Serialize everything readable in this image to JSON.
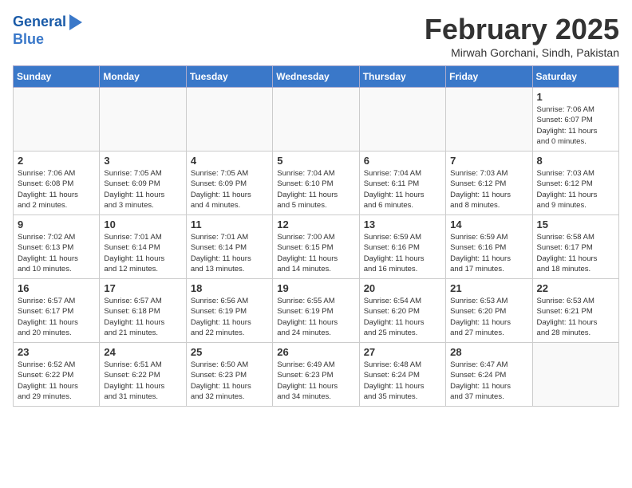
{
  "header": {
    "logo_line1": "General",
    "logo_line2": "Blue",
    "month_title": "February 2025",
    "location": "Mirwah Gorchani, Sindh, Pakistan"
  },
  "weekdays": [
    "Sunday",
    "Monday",
    "Tuesday",
    "Wednesday",
    "Thursday",
    "Friday",
    "Saturday"
  ],
  "weeks": [
    [
      {
        "day": "",
        "info": ""
      },
      {
        "day": "",
        "info": ""
      },
      {
        "day": "",
        "info": ""
      },
      {
        "day": "",
        "info": ""
      },
      {
        "day": "",
        "info": ""
      },
      {
        "day": "",
        "info": ""
      },
      {
        "day": "1",
        "info": "Sunrise: 7:06 AM\nSunset: 6:07 PM\nDaylight: 11 hours\nand 0 minutes."
      }
    ],
    [
      {
        "day": "2",
        "info": "Sunrise: 7:06 AM\nSunset: 6:08 PM\nDaylight: 11 hours\nand 2 minutes."
      },
      {
        "day": "3",
        "info": "Sunrise: 7:05 AM\nSunset: 6:09 PM\nDaylight: 11 hours\nand 3 minutes."
      },
      {
        "day": "4",
        "info": "Sunrise: 7:05 AM\nSunset: 6:09 PM\nDaylight: 11 hours\nand 4 minutes."
      },
      {
        "day": "5",
        "info": "Sunrise: 7:04 AM\nSunset: 6:10 PM\nDaylight: 11 hours\nand 5 minutes."
      },
      {
        "day": "6",
        "info": "Sunrise: 7:04 AM\nSunset: 6:11 PM\nDaylight: 11 hours\nand 6 minutes."
      },
      {
        "day": "7",
        "info": "Sunrise: 7:03 AM\nSunset: 6:12 PM\nDaylight: 11 hours\nand 8 minutes."
      },
      {
        "day": "8",
        "info": "Sunrise: 7:03 AM\nSunset: 6:12 PM\nDaylight: 11 hours\nand 9 minutes."
      }
    ],
    [
      {
        "day": "9",
        "info": "Sunrise: 7:02 AM\nSunset: 6:13 PM\nDaylight: 11 hours\nand 10 minutes."
      },
      {
        "day": "10",
        "info": "Sunrise: 7:01 AM\nSunset: 6:14 PM\nDaylight: 11 hours\nand 12 minutes."
      },
      {
        "day": "11",
        "info": "Sunrise: 7:01 AM\nSunset: 6:14 PM\nDaylight: 11 hours\nand 13 minutes."
      },
      {
        "day": "12",
        "info": "Sunrise: 7:00 AM\nSunset: 6:15 PM\nDaylight: 11 hours\nand 14 minutes."
      },
      {
        "day": "13",
        "info": "Sunrise: 6:59 AM\nSunset: 6:16 PM\nDaylight: 11 hours\nand 16 minutes."
      },
      {
        "day": "14",
        "info": "Sunrise: 6:59 AM\nSunset: 6:16 PM\nDaylight: 11 hours\nand 17 minutes."
      },
      {
        "day": "15",
        "info": "Sunrise: 6:58 AM\nSunset: 6:17 PM\nDaylight: 11 hours\nand 18 minutes."
      }
    ],
    [
      {
        "day": "16",
        "info": "Sunrise: 6:57 AM\nSunset: 6:17 PM\nDaylight: 11 hours\nand 20 minutes."
      },
      {
        "day": "17",
        "info": "Sunrise: 6:57 AM\nSunset: 6:18 PM\nDaylight: 11 hours\nand 21 minutes."
      },
      {
        "day": "18",
        "info": "Sunrise: 6:56 AM\nSunset: 6:19 PM\nDaylight: 11 hours\nand 22 minutes."
      },
      {
        "day": "19",
        "info": "Sunrise: 6:55 AM\nSunset: 6:19 PM\nDaylight: 11 hours\nand 24 minutes."
      },
      {
        "day": "20",
        "info": "Sunrise: 6:54 AM\nSunset: 6:20 PM\nDaylight: 11 hours\nand 25 minutes."
      },
      {
        "day": "21",
        "info": "Sunrise: 6:53 AM\nSunset: 6:20 PM\nDaylight: 11 hours\nand 27 minutes."
      },
      {
        "day": "22",
        "info": "Sunrise: 6:53 AM\nSunset: 6:21 PM\nDaylight: 11 hours\nand 28 minutes."
      }
    ],
    [
      {
        "day": "23",
        "info": "Sunrise: 6:52 AM\nSunset: 6:22 PM\nDaylight: 11 hours\nand 29 minutes."
      },
      {
        "day": "24",
        "info": "Sunrise: 6:51 AM\nSunset: 6:22 PM\nDaylight: 11 hours\nand 31 minutes."
      },
      {
        "day": "25",
        "info": "Sunrise: 6:50 AM\nSunset: 6:23 PM\nDaylight: 11 hours\nand 32 minutes."
      },
      {
        "day": "26",
        "info": "Sunrise: 6:49 AM\nSunset: 6:23 PM\nDaylight: 11 hours\nand 34 minutes."
      },
      {
        "day": "27",
        "info": "Sunrise: 6:48 AM\nSunset: 6:24 PM\nDaylight: 11 hours\nand 35 minutes."
      },
      {
        "day": "28",
        "info": "Sunrise: 6:47 AM\nSunset: 6:24 PM\nDaylight: 11 hours\nand 37 minutes."
      },
      {
        "day": "",
        "info": ""
      }
    ]
  ]
}
